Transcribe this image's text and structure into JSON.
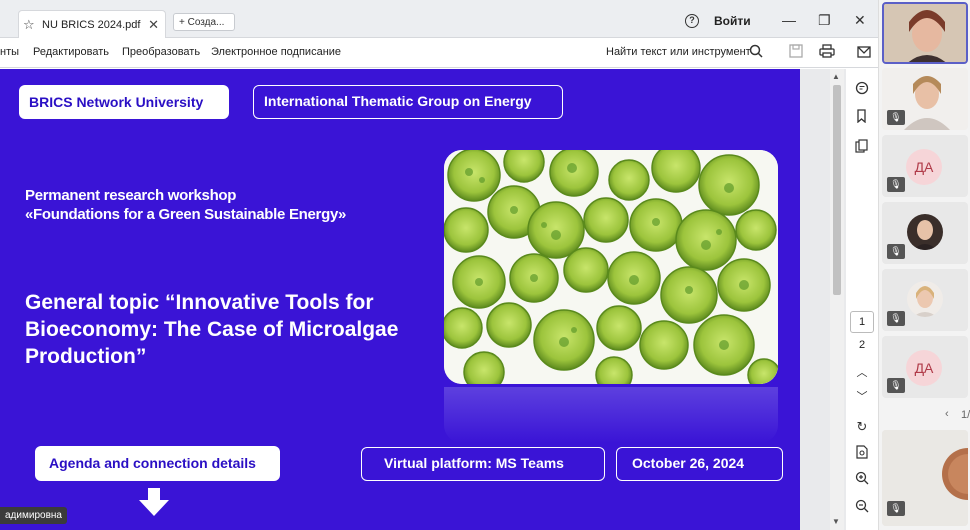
{
  "browser": {
    "tab_left_fragment": "",
    "tab_title": "NU BRICS 2024.pdf",
    "new_tab_label": "+ Созда...",
    "sign_in": "Войти"
  },
  "toolbar": {
    "menu_cut": "нты",
    "menu": [
      "Редактировать",
      "Преобразовать",
      "Электронное подписание"
    ],
    "search_text": "Найти текст или инструмент"
  },
  "slide": {
    "brand_box": "BRICS Network University",
    "group_box": "International Thematic Group on Energy",
    "workshop_line1": "Permanent research workshop",
    "workshop_line2": "«Foundations for a Green Sustainable Energy»",
    "topic_line1": "General topic “Innovative Tools for",
    "topic_line2": "Bioeconomy: The Case of Microalgae",
    "topic_line3": "Production”",
    "agenda_box": "Agenda and connection details",
    "platform_box": "Virtual platform: MS Teams",
    "date_box": "October 26, 2024"
  },
  "speaker_name_tag": "адимировна",
  "pagination": {
    "current_page": "1",
    "total_pages": "2"
  },
  "participants": [
    {
      "type": "video",
      "active": true,
      "muted": false
    },
    {
      "type": "video",
      "active": false,
      "muted": true
    },
    {
      "type": "initials",
      "initials": "ДА",
      "muted": true
    },
    {
      "type": "avatar",
      "muted": true
    },
    {
      "type": "avatar",
      "muted": true
    },
    {
      "type": "initials",
      "initials": "ДА",
      "muted": true
    }
  ],
  "participants_pager": "1/",
  "colors": {
    "slide_bg": "#3a14d6",
    "slide_text": "#ffffff",
    "box_text": "#2a0fc4",
    "initials_bg": "#f6d5d8",
    "initials_text": "#b03a48",
    "teams_accent": "#5b5fc7"
  }
}
